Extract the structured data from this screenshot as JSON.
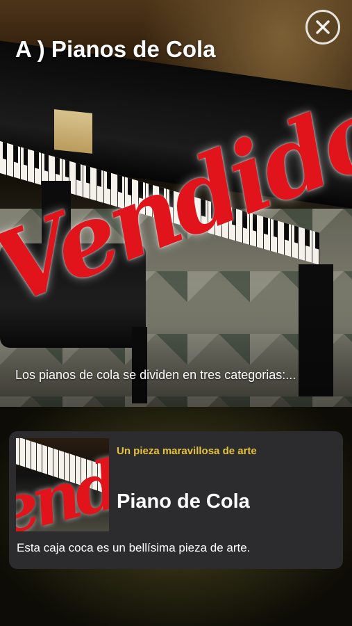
{
  "header": {
    "title": "A ) Pianos de Cola",
    "close_icon": "close-icon"
  },
  "hero": {
    "image_subject": "grand piano",
    "stamp_text": "Vendido",
    "description": "Los pianos de cola se dividen en tres categorias:..."
  },
  "card": {
    "subtitle": "Un  pieza maravillosa de arte",
    "title": "Piano de Cola",
    "description": "Esta caja coca es un bellísima pieza de arte."
  },
  "colors": {
    "accent": "#e6c33a",
    "stamp": "#e0141a",
    "card_bg": "#2c2b2e"
  }
}
